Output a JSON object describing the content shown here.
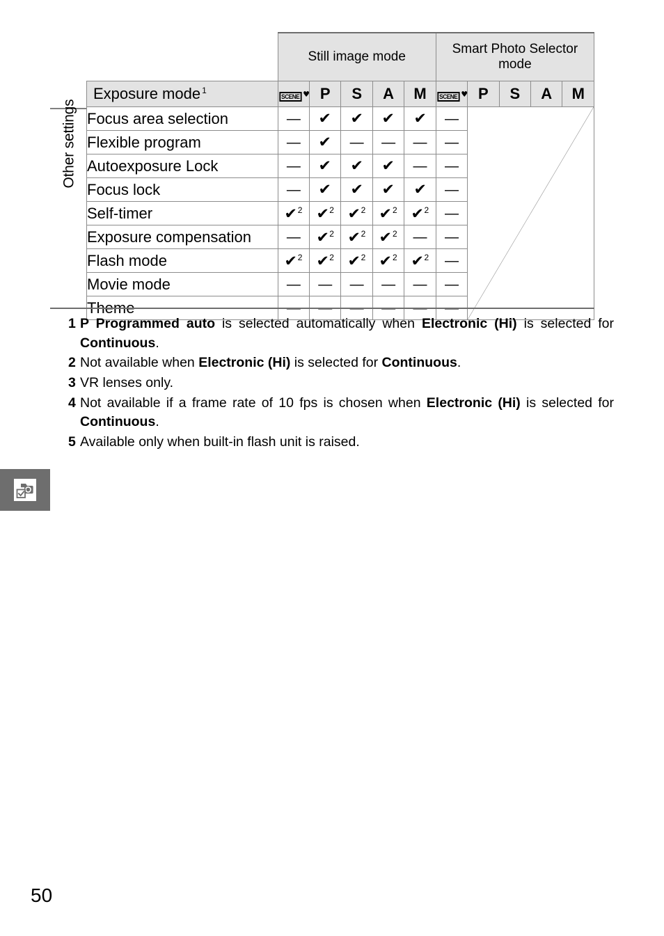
{
  "page": {
    "number": "50",
    "tab_icon": "camera-checkbox-icon"
  },
  "table": {
    "side_label": "Other settings",
    "groups": [
      {
        "label": "Still image mode",
        "span": 5
      },
      {
        "label": "Smart Photo Selector mode",
        "span": 5
      }
    ],
    "row_header_label": "Exposure mode",
    "row_header_footnote": "1",
    "mode_columns": [
      {
        "type": "scene",
        "label": "SCENE",
        "heart": "♥"
      },
      {
        "type": "text",
        "label": "P"
      },
      {
        "type": "text",
        "label": "S"
      },
      {
        "type": "text",
        "label": "A"
      },
      {
        "type": "text",
        "label": "M"
      },
      {
        "type": "scene",
        "label": "SCENE",
        "heart": "♥"
      },
      {
        "type": "text",
        "label": "P"
      },
      {
        "type": "text",
        "label": "S"
      },
      {
        "type": "text",
        "label": "A"
      },
      {
        "type": "text",
        "label": "M"
      }
    ],
    "check_glyph": "✔",
    "dash_glyph": "—",
    "rows": [
      {
        "label": "Focus area selection",
        "cells": [
          {
            "v": "dash"
          },
          {
            "v": "check"
          },
          {
            "v": "check"
          },
          {
            "v": "check"
          },
          {
            "v": "check"
          },
          {
            "v": "dash"
          }
        ]
      },
      {
        "label": "Flexible program",
        "cells": [
          {
            "v": "dash"
          },
          {
            "v": "check"
          },
          {
            "v": "dash"
          },
          {
            "v": "dash"
          },
          {
            "v": "dash"
          },
          {
            "v": "dash"
          }
        ]
      },
      {
        "label": "Autoexposure Lock",
        "cells": [
          {
            "v": "dash"
          },
          {
            "v": "check"
          },
          {
            "v": "check"
          },
          {
            "v": "check"
          },
          {
            "v": "dash"
          },
          {
            "v": "dash"
          }
        ]
      },
      {
        "label": "Focus lock",
        "cells": [
          {
            "v": "dash"
          },
          {
            "v": "check"
          },
          {
            "v": "check"
          },
          {
            "v": "check"
          },
          {
            "v": "check"
          },
          {
            "v": "dash"
          }
        ]
      },
      {
        "label": "Self-timer",
        "cells": [
          {
            "v": "check",
            "sup": "2"
          },
          {
            "v": "check",
            "sup": "2"
          },
          {
            "v": "check",
            "sup": "2"
          },
          {
            "v": "check",
            "sup": "2"
          },
          {
            "v": "check",
            "sup": "2"
          },
          {
            "v": "dash"
          }
        ]
      },
      {
        "label": "Exposure compensation",
        "cells": [
          {
            "v": "dash"
          },
          {
            "v": "check",
            "sup": "2"
          },
          {
            "v": "check",
            "sup": "2"
          },
          {
            "v": "check",
            "sup": "2"
          },
          {
            "v": "dash"
          },
          {
            "v": "dash"
          }
        ]
      },
      {
        "label": "Flash mode",
        "cells": [
          {
            "v": "check",
            "sup": "2"
          },
          {
            "v": "check",
            "sup": "2"
          },
          {
            "v": "check",
            "sup": "2"
          },
          {
            "v": "check",
            "sup": "2"
          },
          {
            "v": "check",
            "sup": "2"
          },
          {
            "v": "dash"
          }
        ]
      },
      {
        "label": "Movie mode",
        "cells": [
          {
            "v": "dash"
          },
          {
            "v": "dash"
          },
          {
            "v": "dash"
          },
          {
            "v": "dash"
          },
          {
            "v": "dash"
          },
          {
            "v": "dash"
          }
        ]
      },
      {
        "label": "Theme",
        "cells": [
          {
            "v": "dash"
          },
          {
            "v": "dash"
          },
          {
            "v": "dash"
          },
          {
            "v": "dash"
          },
          {
            "v": "dash"
          },
          {
            "v": "dash"
          }
        ]
      }
    ]
  },
  "footnotes": [
    {
      "num": "1",
      "html": "<b>P Programmed auto</b> is selected automatically when <b>Electronic (Hi)</b> is selected for <b>Continuous</b>."
    },
    {
      "num": "2",
      "html": "Not available when <b>Electronic (Hi)</b> is selected for <b>Continuous</b>."
    },
    {
      "num": "3",
      "html": "VR lenses only."
    },
    {
      "num": "4",
      "html": "Not available if a frame rate of 10 fps is chosen when <b>Electronic (Hi)</b> is selected for <b>Continuous</b>."
    },
    {
      "num": "5",
      "html": "Available only when built-in flash unit is raised."
    }
  ],
  "colors": {
    "header_fill": "#e3e3e3",
    "rule": "#8c8c8c",
    "heavy_rule": "#6e6e6e",
    "tab_fill": "#6e6e6e"
  }
}
